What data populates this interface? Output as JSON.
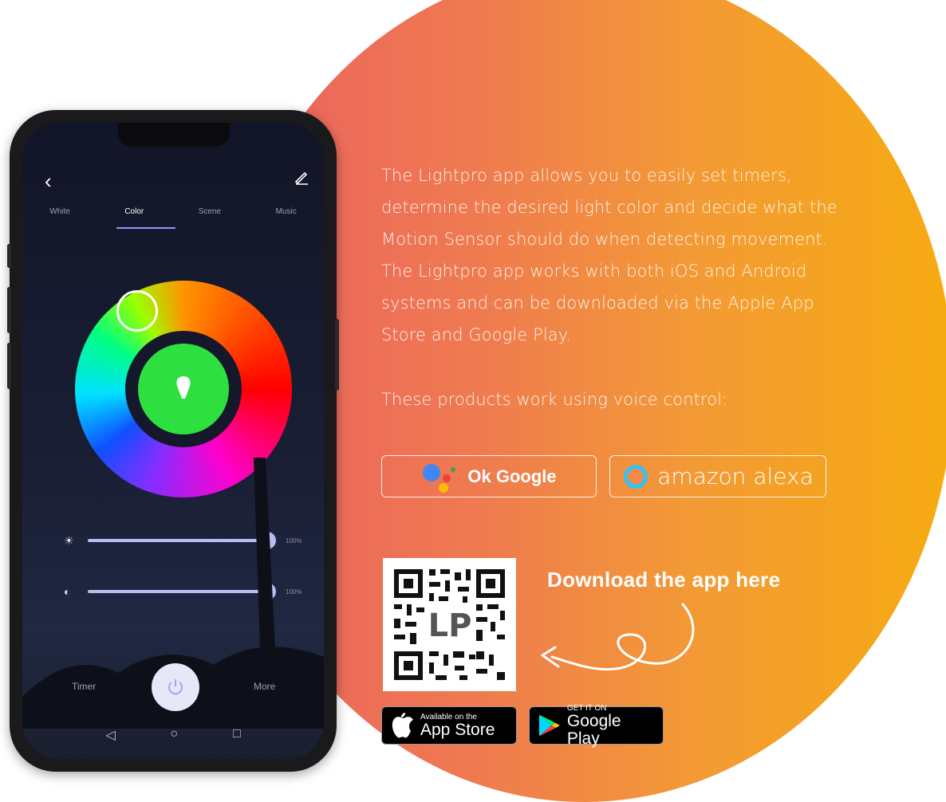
{
  "description": {
    "paragraph": "The Lightpro app allows you to easily set timers, determine the desired light color and decide what the Motion Sensor should do when detecting movement. The Lightpro app works with both iOS and Android systems and can be downloaded via the Apple App Store and Google Play.",
    "voice_heading": "These products work using voice control:"
  },
  "voice_badges": {
    "google": "Ok Google",
    "alexa": "amazon alexa"
  },
  "download": {
    "cta": "Download the app here",
    "qr_icon": "qr-code-icon"
  },
  "stores": {
    "apple_small": "Available on the",
    "apple_big": "App Store",
    "google_small": "GET IT ON",
    "google_big": "Google Play"
  },
  "phone_app": {
    "tabs": [
      "White",
      "Color",
      "Scene",
      "Music"
    ],
    "active_tab": "Color",
    "selected_color": "#2de03f",
    "brightness_value": "100%",
    "contrast_value": "100%",
    "brightness_level": 1.0,
    "contrast_level": 1.0,
    "timer_label": "Timer",
    "more_label": "More"
  },
  "colors": {
    "gradient_start": "#ea5f62",
    "gradient_end": "#f6ab10",
    "slider": "#b9bcf4"
  }
}
